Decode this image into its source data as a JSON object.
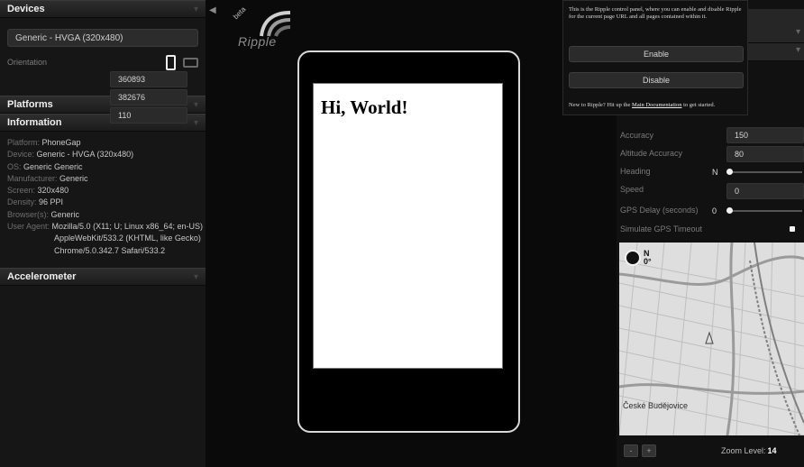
{
  "left": {
    "devices": {
      "title": "Devices",
      "device_value": "Generic - HVGA (320x480)",
      "orientation_label": "Orientation"
    },
    "platforms": {
      "title": "Platforms"
    },
    "information": {
      "title": "Information",
      "rows": [
        {
          "key": "Platform:",
          "value": "PhoneGap"
        },
        {
          "key": "Device:",
          "value": "Generic - HVGA (320x480)"
        },
        {
          "key": "OS:",
          "value": "Generic Generic"
        },
        {
          "key": "Manufacturer:",
          "value": "Generic"
        },
        {
          "key": "Screen:",
          "value": "320x480"
        },
        {
          "key": "Density:",
          "value": "96 PPI"
        },
        {
          "key": "Browser(s):",
          "value": "Generic"
        },
        {
          "key": "User Agent:",
          "value": "Mozilla/5.0 (X11; U; Linux x86_64; en-US)"
        }
      ],
      "ua_line2": "AppleWebKit/533.2 (KHTML, like Gecko)",
      "ua_line3": "Chrome/5.0.342.7 Safari/533.2"
    },
    "accelerometer": {
      "title": "Accelerometer"
    }
  },
  "logo": {
    "beta": "beta",
    "word": "Ripple"
  },
  "device_screen": {
    "heading": "Hi, World!"
  },
  "popup": {
    "message": "This is the Ripple control panel, where you can enable and disable Ripple for the current page URL and all pages contained within it.",
    "enable_label": "Enable",
    "disable_label": "Disable",
    "foot_before": "New to Ripple? Hit up the ",
    "foot_link": "Main Documentation",
    "foot_after": " to get started."
  },
  "geo": {
    "latitude_value": "360893",
    "longitude_value": "382676",
    "altitude_value": "110",
    "accuracy_label": "Accuracy",
    "accuracy_value": "150",
    "altitude_accuracy_label": "Altitude Accuracy",
    "altitude_accuracy_value": "80",
    "heading_label": "Heading",
    "heading_value": "N",
    "speed_label": "Speed",
    "speed_value": "0",
    "gps_delay_label": "GPS Delay (seconds)",
    "gps_delay_value": "0",
    "simulate_timeout_label": "Simulate GPS Timeout"
  },
  "map": {
    "compass_n": "N",
    "compass_deg": "0°",
    "city_label": "České Budějovice",
    "zoom_label": "Zoom Level:",
    "zoom_value": "14",
    "zoom_out_label": "-",
    "zoom_in_label": "+"
  }
}
